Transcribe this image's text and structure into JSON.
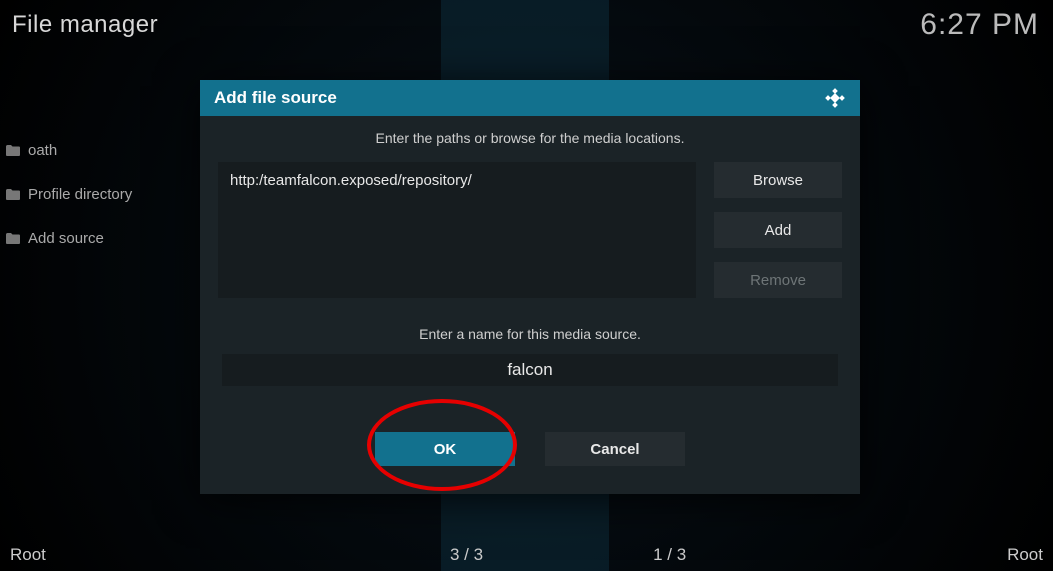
{
  "header": {
    "title": "File manager",
    "clock": "6:27 PM"
  },
  "sidebar": {
    "items": [
      {
        "label": "oath"
      },
      {
        "label": "Profile directory"
      },
      {
        "label": "Add source"
      }
    ]
  },
  "footer": {
    "left": "Root",
    "center_left": "3 / 3",
    "center_right": "1 / 3",
    "right": "Root"
  },
  "dialog": {
    "title": "Add file source",
    "paths_hint": "Enter the paths or browse for the media locations.",
    "path_value": "http:/teamfalcon.exposed/repository/",
    "buttons": {
      "browse": "Browse",
      "add": "Add",
      "remove": "Remove"
    },
    "name_hint": "Enter a name for this media source.",
    "name_value": "falcon",
    "ok": "OK",
    "cancel": "Cancel"
  }
}
